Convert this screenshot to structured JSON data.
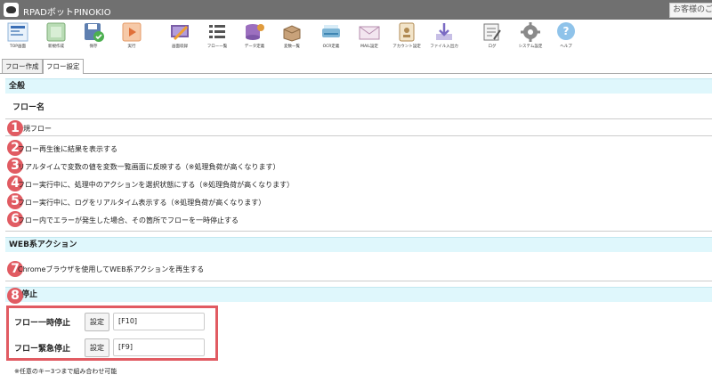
{
  "app": {
    "title": "RPADボットPINOKIO",
    "customer_label": "お客様のご"
  },
  "toolbar": {
    "top_screen": "TOP画面",
    "new_create": "新規作成",
    "save": "保存",
    "run": "実行",
    "screen_record": "画面収録",
    "flow_list": "フロー一覧",
    "data_def": "データ定義",
    "value_list": "変数一覧",
    "ocr_def": "OCR定義",
    "mail_settings": "MAIL設定",
    "account_settings": "アカウント設定",
    "file_import": "ファイル入出力",
    "log": "ログ",
    "system_settings": "システム設定",
    "help": "ヘルプ"
  },
  "tabs": [
    {
      "label": "フロー作成"
    },
    {
      "label": "フロー設定"
    }
  ],
  "general": {
    "header": "全般",
    "flow_name_label": "フロー名",
    "flow_name_value": "新規フロー",
    "options": [
      "フロー再生後に結果を表示する",
      "リアルタイムで変数の値を変数一覧画面に反映する（※処理負荷が高くなります）",
      "フロー実行中に、処理中のアクションを選択状態にする（※処理負荷が高くなります）",
      "フロー実行中に、ログをリアルタイム表示する（※処理負荷が高くなります）",
      "フロー内でエラーが発生した場合、その箇所でフローを一時停止する"
    ]
  },
  "web": {
    "header": "WEB系アクション",
    "option": "Chromeブラウザを使用してWEB系アクションを再生する"
  },
  "pause": {
    "header": "停止",
    "pause_label": "フロー一時停止",
    "pause_set": "設定",
    "pause_key": "[F10]",
    "emergency_label": "フロー緊急停止",
    "emergency_set": "設定",
    "emergency_key": "[F9]",
    "note": "※任意のキー3つまで組み合わせ可能"
  },
  "badges": [
    "1",
    "2",
    "3",
    "4",
    "5",
    "6",
    "7",
    "8"
  ],
  "colors": {
    "badge": "#e15b62",
    "section_bg": "#dff7fc",
    "titlebar": "#707070"
  }
}
